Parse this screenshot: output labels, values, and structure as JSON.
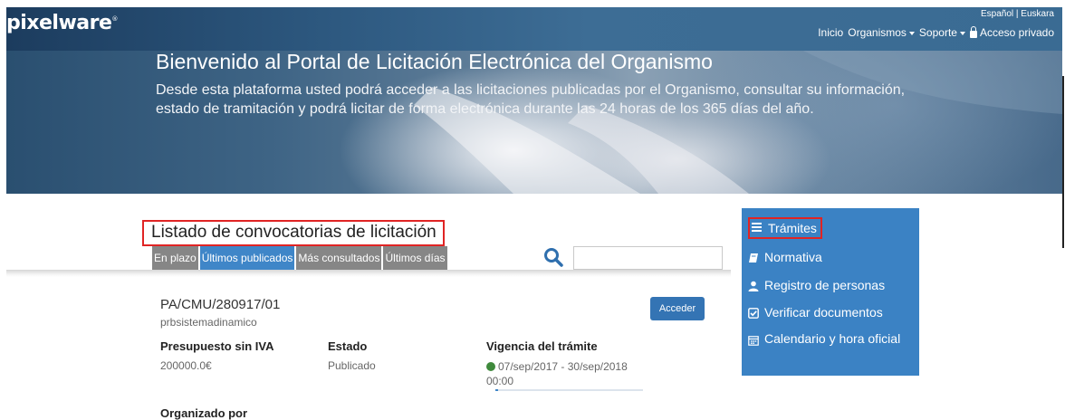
{
  "header": {
    "logo_text": "pixelware",
    "logo_mark": "®",
    "languages": "Español | Euskara",
    "nav": {
      "inicio": "Inicio",
      "organismos": "Organismos",
      "soporte": "Soporte",
      "acceso": "Acceso privado"
    }
  },
  "hero": {
    "title": "Bienvenido al Portal de Licitación Electrónica del Organismo",
    "text": "Desde esta plataforma usted podrá acceder a las licitaciones publicadas por el Organismo, consultar su información, estado de tramitación y podrá licitar de forma electrónica durante las 24 horas de los 365 días del año."
  },
  "listing": {
    "title": "Listado de convocatorias de licitación",
    "tabs": [
      {
        "label": "En plazo",
        "active": false
      },
      {
        "label": "Últimos publicados",
        "active": true
      },
      {
        "label": "Más consultados",
        "active": false
      },
      {
        "label": "Últimos días",
        "active": false
      }
    ],
    "search_value": "",
    "item": {
      "code": "PA/CMU/280917/01",
      "subtitle": "prbsistemadinamico",
      "button": "Acceder",
      "presupuesto_label": "Presupuesto sin IVA",
      "presupuesto_value": "200000.0€",
      "estado_label": "Estado",
      "estado_value": "Publicado",
      "vigencia_label": "Vigencia del trámite",
      "vigencia_value": "07/sep/2017 - 30/sep/2018 00:00",
      "vigencia_progress": 0.02,
      "organizado_label": "Organizado por"
    }
  },
  "side_menu": [
    {
      "label": "Trámites",
      "icon": "list-icon"
    },
    {
      "label": "Normativa",
      "icon": "book-icon"
    },
    {
      "label": "Registro de personas",
      "icon": "user-icon"
    },
    {
      "label": "Verificar documentos",
      "icon": "check-square-icon"
    },
    {
      "label": "Calendario y hora oficial",
      "icon": "calendar-icon"
    }
  ],
  "colors": {
    "accent": "#3b82c4",
    "tab_inactive": "#868686",
    "highlight": "#e02424",
    "status_dot": "#3f8a3c"
  }
}
